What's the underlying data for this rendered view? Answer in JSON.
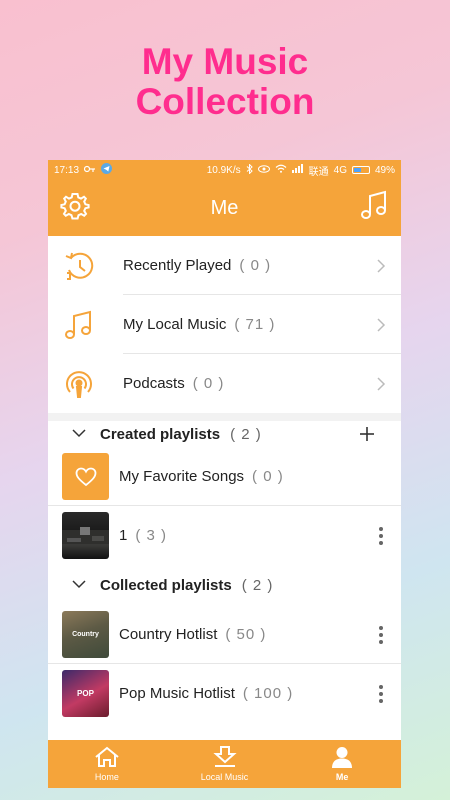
{
  "promo": {
    "line1": "My Music",
    "line2": "Collection"
  },
  "status_bar": {
    "time": "17:13",
    "speed": "10.9K/s",
    "carrier": "联通",
    "network": "4G",
    "battery": "49%",
    "battery_level": 0.49
  },
  "header": {
    "title": "Me",
    "left_icon": "gear-icon",
    "right_icon": "music-note-icon"
  },
  "menu": [
    {
      "label": "Recently Played",
      "count": "( 0 )",
      "icon": "clock-icon"
    },
    {
      "label": "My Local Music",
      "count": "( 71 )",
      "icon": "music-note-icon"
    },
    {
      "label": "Podcasts",
      "count": "( 0 )",
      "icon": "podcast-icon"
    }
  ],
  "created": {
    "title": "Created playlists",
    "count": "( 2 )",
    "items": [
      {
        "label": "My Favorite Songs",
        "count": "( 0 )"
      },
      {
        "label": "1",
        "count": "( 3 )"
      }
    ]
  },
  "collected": {
    "title": "Collected playlists",
    "count": "( 2 )",
    "items": [
      {
        "label": "Country Hotlist",
        "count": "( 50 )",
        "thumb_text": "Country"
      },
      {
        "label": "Pop Music Hotlist",
        "count": "( 100 )",
        "thumb_text": "POP"
      }
    ]
  },
  "tabs": [
    {
      "label": "Home",
      "icon": "home-icon"
    },
    {
      "label": "Local Music",
      "icon": "download-icon"
    },
    {
      "label": "Me",
      "icon": "person-icon"
    }
  ],
  "colors": {
    "accent": "#f5a43a",
    "promo": "#ff2d8e"
  }
}
